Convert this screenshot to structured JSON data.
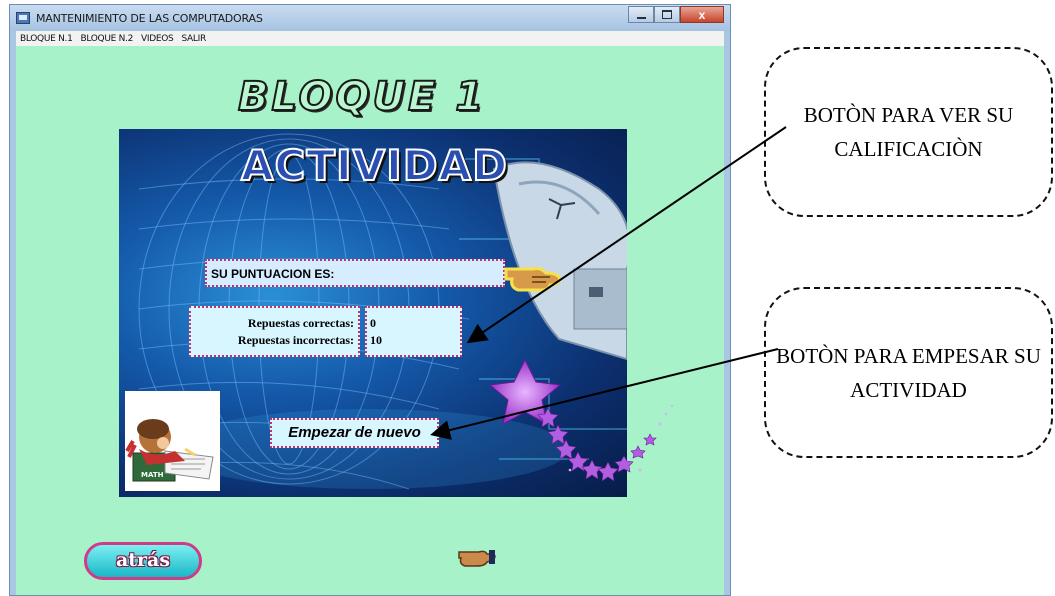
{
  "window": {
    "title": "MANTENIMIENTO DE LAS COMPUTADORAS",
    "menu": [
      "BLOQUE N.1",
      "BLOQUE N.2",
      "VIDEOS",
      "SALIR"
    ],
    "close_label": "x"
  },
  "page": {
    "heading": "BLOQUE 1",
    "activity_heading": "ACTIVIDAD",
    "score_label": "SU PUNTUACION ES:",
    "correct_label": "Repuestas correctas:",
    "incorrect_label": "Repuestas incorrectas:",
    "correct_value": "0",
    "incorrect_value": "10",
    "restart_button": "Empezar de nuevo",
    "back_button": "atrás",
    "image_caption": "MATH"
  },
  "callouts": {
    "grade": "BOTÒN PARA VER SU CALIFICACIÒN",
    "start": "BOTÒN PARA EMPESAR SU ACTIVIDAD"
  },
  "colors": {
    "window_bg": "#a7f2c8",
    "box_border": "#c4306d",
    "back_button": "#19b7c6"
  }
}
